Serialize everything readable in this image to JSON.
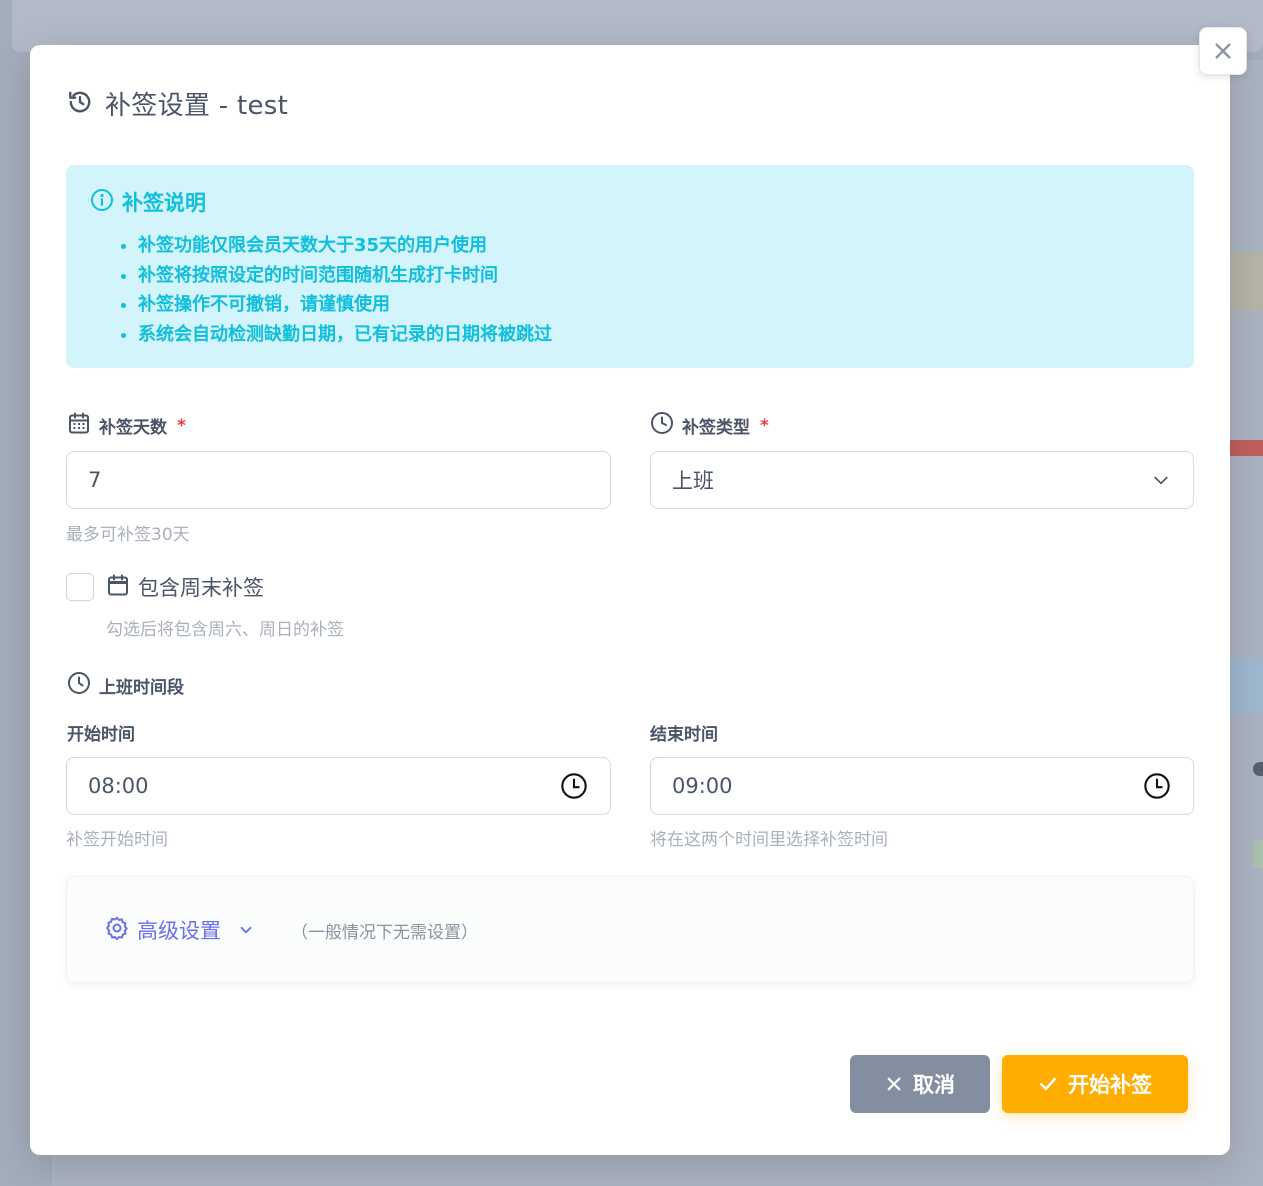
{
  "dialog": {
    "title": "补签设置 - test",
    "info": {
      "heading": "补签说明",
      "items": [
        "补签功能仅限会员天数大于35天的用户使用",
        "补签将按照设定的时间范围随机生成打卡时间",
        "补签操作不可撤销，请谨慎使用",
        "系统会自动检测缺勤日期，已有记录的日期将被跳过"
      ]
    },
    "days": {
      "label": "补签天数",
      "required_mark": "*",
      "value": "7",
      "hint": "最多可补签30天"
    },
    "type": {
      "label": "补签类型",
      "required_mark": "*",
      "value": "上班"
    },
    "weekend": {
      "label": "包含周末补签",
      "checked": false,
      "hint": "勾选后将包含周六、周日的补签"
    },
    "period": {
      "label": "上班时间段",
      "start": {
        "label": "开始时间",
        "value": "08:00",
        "hint": "补签开始时间"
      },
      "end": {
        "label": "结束时间",
        "value": "09:00",
        "hint": "将在这两个时间里选择补签时间"
      }
    },
    "advanced": {
      "label": "高级设置",
      "note": "（一般情况下无需设置）"
    },
    "buttons": {
      "cancel": "取消",
      "start": "开始补签"
    }
  },
  "colors": {
    "accent_cyan": "#0fbfdc",
    "info_bg": "#d3f4fb",
    "primary_orange": "#ffad00",
    "cancel_gray": "#838fa1",
    "advanced_purple": "#6a6ff0",
    "required_red": "#e53e3e"
  },
  "icons": [
    "history-icon",
    "info-icon",
    "calendar-icon",
    "clock-icon",
    "chevron-down-icon",
    "gear-icon",
    "close-icon",
    "check-icon"
  ]
}
